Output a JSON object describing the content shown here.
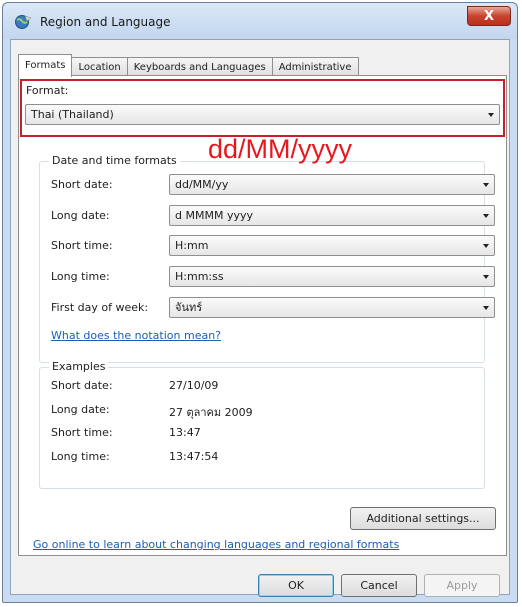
{
  "window": {
    "title": "Region and Language",
    "close_label": "X"
  },
  "tabs": [
    {
      "label": "Formats"
    },
    {
      "label": "Location"
    },
    {
      "label": "Keyboards and Languages"
    },
    {
      "label": "Administrative"
    }
  ],
  "format": {
    "label": "Format:",
    "value": "Thai (Thailand)"
  },
  "date_time_formats": {
    "title": "Date and time formats",
    "rows": [
      {
        "label": "Short date:",
        "value": "dd/MM/yy"
      },
      {
        "label": "Long date:",
        "value": "d MMMM yyyy"
      },
      {
        "label": "Short time:",
        "value": "H:mm"
      },
      {
        "label": "Long time:",
        "value": "H:mm:ss"
      },
      {
        "label": "First day of week:",
        "value": "จันทร์"
      }
    ],
    "notation_link": "What does the notation mean?"
  },
  "overlay_annotation": "dd/MM/yyyy",
  "examples": {
    "title": "Examples",
    "rows": [
      {
        "label": "Short date:",
        "value": "27/10/09"
      },
      {
        "label": "Long date:",
        "value": "27 ตุลาคม 2009"
      },
      {
        "label": "Short time:",
        "value": "13:47"
      },
      {
        "label": "Long time:",
        "value": "13:47:54"
      }
    ]
  },
  "additional_settings_label": "Additional settings...",
  "online_link": "Go online to learn about changing languages and regional formats",
  "buttons": {
    "ok": "OK",
    "cancel": "Cancel",
    "apply": "Apply"
  },
  "colors": {
    "highlight_border": "#c8202a",
    "annotation": "#e8171f",
    "link": "#1a5fb4"
  }
}
